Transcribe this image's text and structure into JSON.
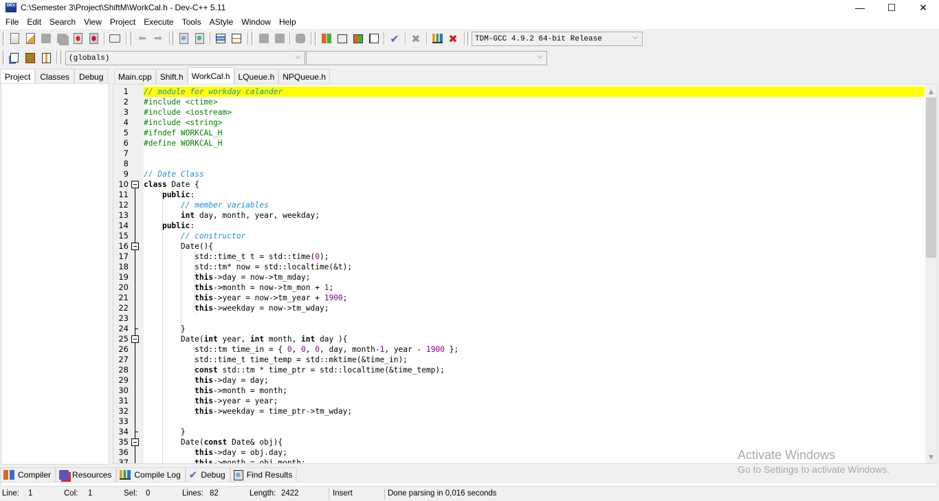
{
  "window": {
    "title": "C:\\Semester 3\\Project\\ShiftM\\WorkCal.h - Dev-C++ 5.11",
    "app_icon_text": "DEV",
    "minimize": "—",
    "maximize": "☐",
    "close": "✕"
  },
  "menu": [
    "File",
    "Edit",
    "Search",
    "View",
    "Project",
    "Execute",
    "Tools",
    "AStyle",
    "Window",
    "Help"
  ],
  "toolbar": {
    "compiler_select": "TDM-GCC 4.9.2 64-bit Release",
    "scope_select": "(globals)",
    "function_select": "",
    "icons": [
      "new-file-icon",
      "open-file-icon",
      "save-icon",
      "save-all-icon",
      "close-icon",
      "close-all-icon",
      "print-icon",
      "undo-icon",
      "redo-icon",
      "find-icon",
      "replace-icon",
      "indent-icon",
      "unindent-icon",
      "bookmark-prev-icon",
      "bookmark-next-icon",
      "toggle-comment-icon",
      "compile-icon",
      "run-icon",
      "compile-run-icon",
      "rebuild-all-icon",
      "syntax-check-icon",
      "stop-icon",
      "profile-icon",
      "delete-profile-icon"
    ],
    "project_icons": [
      "new-project-icon",
      "add-to-project-icon",
      "remove-from-project-icon"
    ]
  },
  "left_tabs": [
    "Project",
    "Classes",
    "Debug"
  ],
  "editor_tabs": [
    "Main.cpp",
    "Shift.h",
    "WorkCal.h",
    "LQueue.h",
    "NPQueue.h"
  ],
  "active_editor_tab": "WorkCal.h",
  "code_lines": [
    "// module for workday calander",
    "#include <ctime>",
    "#include <iostream>",
    "#include <string>",
    "#ifndef WORKCAL_H",
    "#define WORKCAL_H",
    "",
    "",
    "// Date Class",
    "class Date {",
    "    public:",
    "        // member variables",
    "        int day, month, year, weekday;",
    "    public:",
    "        // constructor",
    "        Date(){",
    "           std::time_t t = std::time(0);",
    "           std::tm* now = std::localtime(&t);",
    "           this->day = now->tm_mday;",
    "           this->month = now->tm_mon + 1;",
    "           this->year = now->tm_year + 1900;",
    "           this->weekday = now->tm_wday;",
    "",
    "        }",
    "        Date(int year, int month, int day ){",
    "           std::tm time_in = { 0, 0, 0, day, month-1, year - 1900 };",
    "           std::time_t time_temp = std::mktime(&time_in);",
    "           const std::tm * time_ptr = std::localtime(&time_temp);",
    "           this->day = day;",
    "           this->month = month;",
    "           this->year = year;",
    "           this->weekday = time_ptr->tm_wday;",
    "",
    "        }",
    "        Date(const Date& obj){",
    "           this->day = obj.day;",
    "           this->month = obj.month;"
  ],
  "colors": {
    "current_line_highlight": "#ffff00",
    "comment": "#1e8fd6",
    "preprocessor": "#008000",
    "number": "#800080"
  },
  "bottom_tabs": [
    {
      "label": "Compiler",
      "icon": "compiler-icon"
    },
    {
      "label": "Resources",
      "icon": "resources-icon"
    },
    {
      "label": "Compile Log",
      "icon": "compile-log-icon"
    },
    {
      "label": "Debug",
      "icon": "debug-check-icon"
    },
    {
      "label": "Find Results",
      "icon": "find-results-icon"
    }
  ],
  "status": {
    "line_label": "Line:",
    "line_value": "1",
    "col_label": "Col:",
    "col_value": "1",
    "sel_label": "Sel:",
    "sel_value": "0",
    "lines_label": "Lines:",
    "lines_value": "82",
    "length_label": "Length:",
    "length_value": "2422",
    "mode": "Insert",
    "message": "Done parsing in 0,016 seconds"
  },
  "watermark": {
    "title": "Activate Windows",
    "subtitle": "Go to Settings to activate Windows."
  },
  "scroll": {
    "position_fraction": 0.0,
    "visible_fraction": 0.45
  }
}
